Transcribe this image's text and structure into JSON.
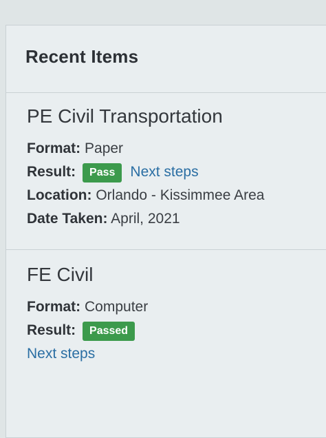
{
  "panel": {
    "title": "Recent Items"
  },
  "items": [
    {
      "title": "PE Civil Transportation",
      "format_label": "Format:",
      "format_value": "Paper",
      "result_label": "Result:",
      "result_badge": "Pass",
      "next_steps": "Next steps",
      "location_label": "Location:",
      "location_value": "Orlando - Kissimmee Area",
      "date_label": "Date Taken:",
      "date_value": "April, 2021"
    },
    {
      "title": "FE Civil",
      "format_label": "Format:",
      "format_value": "Computer",
      "result_label": "Result:",
      "result_badge": "Passed",
      "next_steps": "Next steps"
    }
  ],
  "colors": {
    "badge_green": "#3c9a4c",
    "link_blue": "#2a6ea3",
    "panel_bg": "#e9eef0"
  }
}
